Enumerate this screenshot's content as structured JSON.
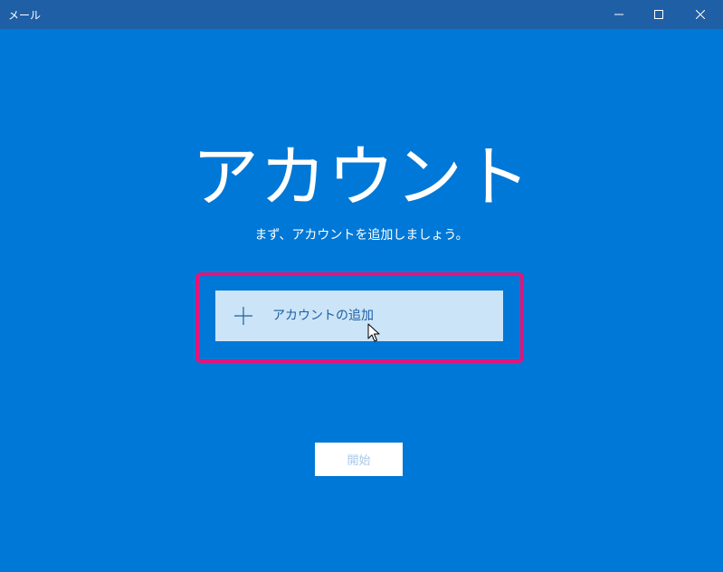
{
  "window": {
    "title": "メール",
    "controls": {
      "minimize_icon": "minimize-icon",
      "maximize_icon": "maximize-icon",
      "close_icon": "close-icon"
    }
  },
  "main": {
    "heading": "アカウント",
    "subtitle": "まず、アカウントを追加しましょう。",
    "add_account": {
      "icon": "plus-icon",
      "label": "アカウントの追加"
    },
    "start_button": {
      "label": "開始",
      "enabled": false
    }
  },
  "colors": {
    "background": "#0078d7",
    "titlebar": "#1f5fa6",
    "button_bg": "#cce4f7",
    "button_text": "#1b5fa5",
    "highlight": "#e5137a",
    "start_button_text": "#a7c7ea"
  }
}
